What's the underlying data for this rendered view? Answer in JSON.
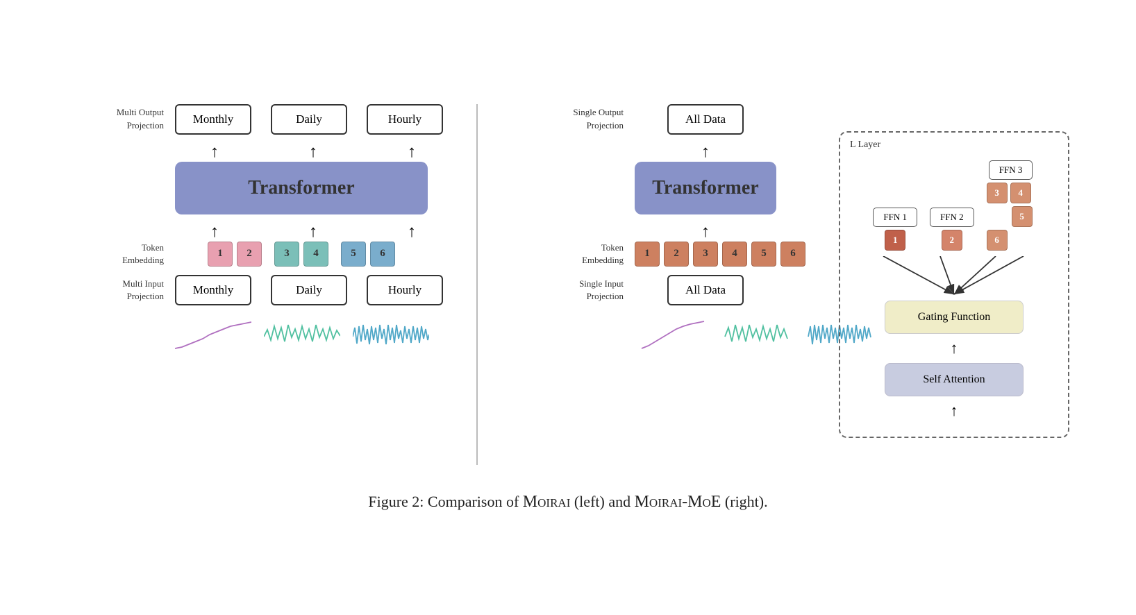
{
  "left": {
    "multiOutputLabel": "Multi Output\nProjection",
    "tokenEmbeddingLabel": "Token\nEmbedding",
    "multiInputLabel": "Multi Input\nProjection",
    "transformerLabel": "Transformer",
    "outputs": [
      "Monthly",
      "Daily",
      "Hourly"
    ],
    "inputs": [
      "Monthly",
      "Daily",
      "Hourly"
    ],
    "tokenGroups": [
      {
        "tokens": [
          {
            "label": "1",
            "color": "pink"
          },
          {
            "label": "2",
            "color": "pink"
          }
        ]
      },
      {
        "tokens": [
          {
            "label": "3",
            "color": "teal"
          },
          {
            "label": "4",
            "color": "teal"
          }
        ]
      },
      {
        "tokens": [
          {
            "label": "5",
            "color": "blue"
          },
          {
            "label": "6",
            "color": "blue"
          }
        ]
      }
    ]
  },
  "right": {
    "singleOutputLabel": "Single Output\nProjection",
    "tokenEmbeddingLabel": "Token\nEmbedding",
    "singleInputLabel": "Single Input\nProjection",
    "transformerLabel": "Transformer",
    "allDataOutput": "All Data",
    "allDataInput": "All Data",
    "tokens": [
      "1",
      "2",
      "3",
      "4",
      "5",
      "6"
    ]
  },
  "llayer": {
    "label": "L Layer",
    "ffns": [
      {
        "label": "FFN 1",
        "tokens": [
          {
            "n": "1",
            "c": "red"
          }
        ]
      },
      {
        "label": "FFN 2",
        "tokens": [
          {
            "n": "2",
            "c": "orange"
          }
        ]
      },
      {
        "label": "FFN 3",
        "tokens": [
          {
            "n": "3",
            "c": "light"
          },
          {
            "n": "4",
            "c": "light"
          }
        ]
      }
    ],
    "extraTokens": [
      {
        "n": "5",
        "c": "light"
      },
      {
        "n": "6",
        "c": "light"
      }
    ],
    "gatingLabel": "Gating Function",
    "selfAttnLabel": "Self Attention"
  },
  "caption": {
    "prefix": "Figure 2: Comparison of ",
    "moirai": "Moirai",
    "middle": " (left) and ",
    "moiraiMoe": "Moirai-MoE",
    "suffix": " (right)."
  }
}
